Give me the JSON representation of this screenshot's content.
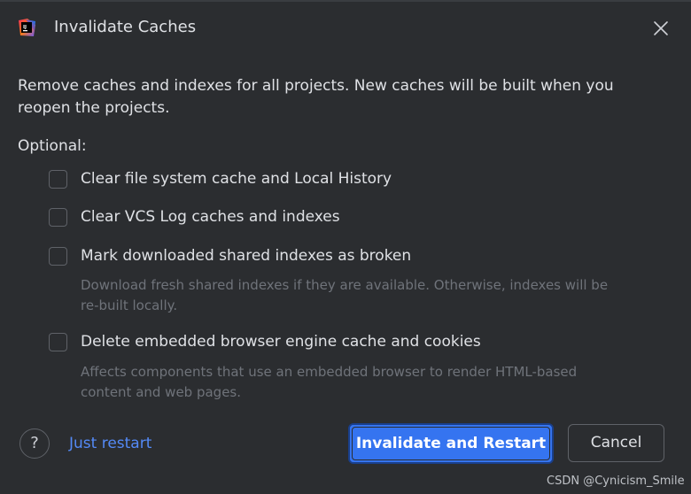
{
  "dialog": {
    "title": "Invalidate Caches",
    "app_icon": "intellij-idea-icon",
    "close_icon": "close-icon"
  },
  "description": "Remove caches and indexes for all projects. New caches will be built when you reopen the projects.",
  "optional_label": "Optional:",
  "options": [
    {
      "label": "Clear file system cache and Local History",
      "checked": false,
      "hint": ""
    },
    {
      "label": "Clear VCS Log caches and indexes",
      "checked": false,
      "hint": ""
    },
    {
      "label": "Mark downloaded shared indexes as broken",
      "checked": false,
      "hint": "Download fresh shared indexes if they are available. Otherwise, indexes will be re-built locally."
    },
    {
      "label": "Delete embedded browser engine cache and cookies",
      "checked": false,
      "hint": "Affects components that use an embedded browser to render HTML-based content and web pages."
    }
  ],
  "footer": {
    "help_symbol": "?",
    "just_restart": "Just restart",
    "primary": "Invalidate and Restart",
    "cancel": "Cancel"
  },
  "watermark": "CSDN @Cynicism_Smile",
  "colors": {
    "background": "#2b2d30",
    "text": "#dfe1e5",
    "hint": "#6f737a",
    "link": "#548af7",
    "primary": "#3574f0"
  }
}
